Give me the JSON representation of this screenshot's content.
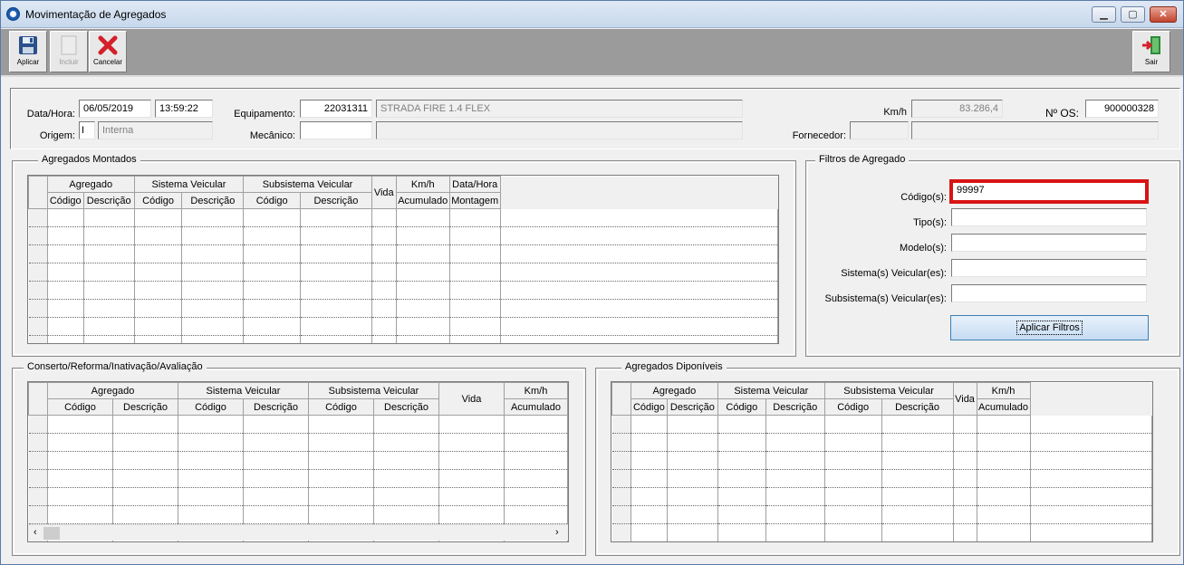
{
  "window": {
    "title": "Movimentação de Agregados"
  },
  "toolbar": {
    "apply_label": "Aplicar",
    "include_label": "Incluir",
    "cancel_label": "Cancelar",
    "exit_label": "Sair"
  },
  "header": {
    "date_label": "Data/Hora:",
    "date_value": "06/05/2019",
    "time_value": "13:59:22",
    "origin_label": "Origem:",
    "origin_code": "I",
    "origin_value": "Interna",
    "equipment_label": "Equipamento:",
    "equipment_code": "22031311",
    "equipment_desc": "STRADA FIRE 1.4 FLEX",
    "mechanic_label": "Mecânico:",
    "mechanic_code": "",
    "mechanic_name": "",
    "kmh_label": "Km/h",
    "kmh_value": "83.286,4",
    "os_label": "Nº OS:",
    "os_value": "900000328",
    "supplier_label": "Fornecedor:",
    "supplier_code": "",
    "supplier_name": ""
  },
  "mounted": {
    "title": "Agregados Montados",
    "group_headers": [
      "Agregado",
      "Sistema Veicular",
      "Subsistema Veicular"
    ],
    "sub_headers": [
      "Código",
      "Descrição",
      "Código",
      "Descrição",
      "Código",
      "Descrição"
    ],
    "vida": "Vida",
    "kmh_line1": "Km/h",
    "kmh_line2": "Acumulado",
    "dh_line1": "Data/Hora",
    "dh_line2": "Montagem"
  },
  "filters": {
    "title": "Filtros de Agregado",
    "code_label": "Código(s):",
    "code_value": "99997",
    "type_label": "Tipo(s):",
    "type_value": "",
    "model_label": "Modelo(s):",
    "model_value": "",
    "system_label": "Sistema(s) Veicular(es):",
    "system_value": "",
    "subsystem_label": "Subsistema(s) Veicular(es):",
    "subsystem_value": "",
    "apply_label": "Aplicar Filtros"
  },
  "repair": {
    "title": "Conserto/Reforma/Inativação/Avaliação",
    "group_headers": [
      "Agregado",
      "Sistema Veicular",
      "Subsistema Veicular"
    ],
    "sub_headers": [
      "Código",
      "Descrição",
      "Código",
      "Descrição",
      "Código",
      "Descrição"
    ],
    "vida": "Vida",
    "kmh_line1": "Km/h",
    "kmh_line2": "Acumulado"
  },
  "available": {
    "title": "Agregados Diponíveis",
    "group_headers": [
      "Agregado",
      "Sistema Veicular",
      "Subsistema Veicular"
    ],
    "sub_headers": [
      "Código",
      "Descrição",
      "Código",
      "Descrição",
      "Código",
      "Descrição"
    ],
    "vida": "Vida",
    "kmh_line1": "Km/h",
    "kmh_line2": "Acumulado"
  },
  "icons": {
    "app": "app-icon",
    "apply": "floppy-disk-icon",
    "include": "blank-page-icon",
    "cancel": "red-x-icon",
    "exit": "exit-door-icon"
  },
  "colors": {
    "highlight": "#d81414",
    "toolbar_bg": "#9b9b9b",
    "window_bg": "#f0f0f0"
  }
}
